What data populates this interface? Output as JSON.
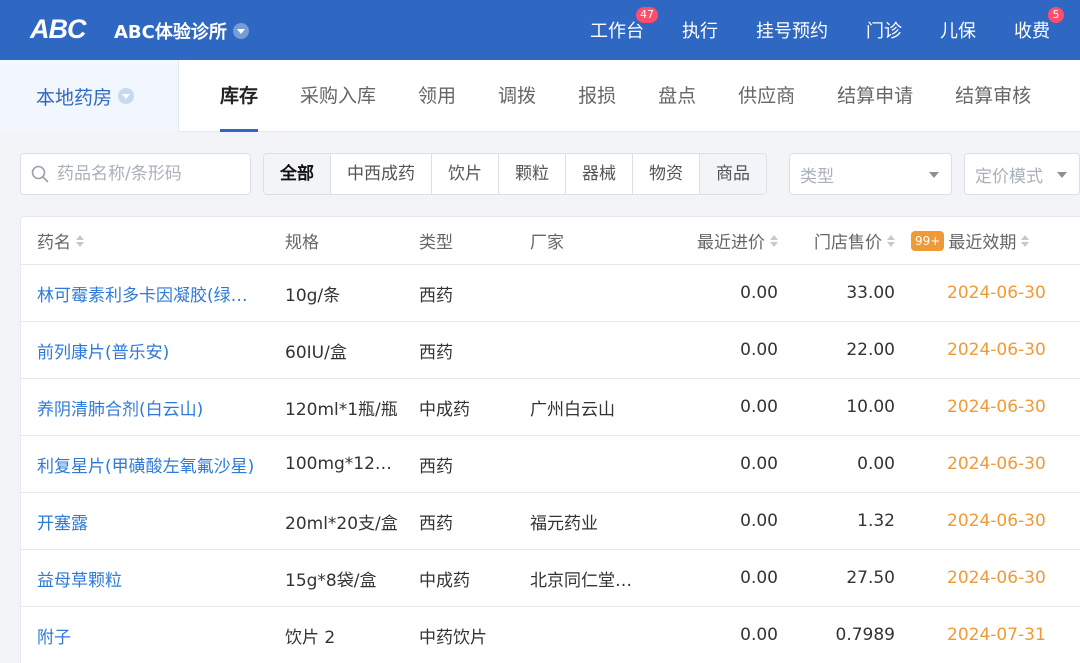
{
  "topbar": {
    "logo": "ABC",
    "clinic_name": "ABC体验诊所",
    "nav": [
      {
        "label": "工作台",
        "badge": "47"
      },
      {
        "label": "执行",
        "badge": ""
      },
      {
        "label": "挂号预约",
        "badge": ""
      },
      {
        "label": "门诊",
        "badge": ""
      },
      {
        "label": "儿保",
        "badge": ""
      },
      {
        "label": "收费",
        "badge": "5"
      }
    ]
  },
  "subbar": {
    "pharmacy": "本地药房",
    "tabs": [
      "库存",
      "采购入库",
      "领用",
      "调拨",
      "报损",
      "盘点",
      "供应商",
      "结算申请",
      "结算审核"
    ],
    "active_tab": "库存"
  },
  "filters": {
    "search_placeholder": "药品名称/条形码",
    "categories": [
      "全部",
      "中西成药",
      "饮片",
      "颗粒",
      "器械",
      "物资",
      "商品"
    ],
    "type_placeholder": "类型",
    "pricing_placeholder": "定价模式"
  },
  "table": {
    "headers": {
      "name": "药名",
      "spec": "规格",
      "type": "类型",
      "manufacturer": "厂家",
      "cost": "最近进价",
      "price": "门店售价",
      "expiry_badge": "99+",
      "expiry": "最近效期"
    },
    "rows": [
      {
        "name": "林可霉素利多卡因凝胶(绿…",
        "spec": "10g/条",
        "type": "西药",
        "manufacturer": "",
        "cost": "0.00",
        "price": "33.00",
        "expiry": "2024-06-30"
      },
      {
        "name": "前列康片(普乐安)",
        "spec": "60IU/盒",
        "type": "西药",
        "manufacturer": "",
        "cost": "0.00",
        "price": "22.00",
        "expiry": "2024-06-30"
      },
      {
        "name": "养阴清肺合剂(白云山)",
        "spec": "120ml*1瓶/瓶",
        "type": "中成药",
        "manufacturer": "广州白云山",
        "cost": "0.00",
        "price": "10.00",
        "expiry": "2024-06-30"
      },
      {
        "name": "利复星片(甲磺酸左氧氟沙星)",
        "spec": "100mg*12…",
        "type": "西药",
        "manufacturer": "",
        "cost": "0.00",
        "price": "0.00",
        "expiry": "2024-06-30"
      },
      {
        "name": "开塞露",
        "spec": "20ml*20支/盒",
        "type": "西药",
        "manufacturer": "福元药业",
        "cost": "0.00",
        "price": "1.32",
        "expiry": "2024-06-30"
      },
      {
        "name": "益母草颗粒",
        "spec": "15g*8袋/盒",
        "type": "中成药",
        "manufacturer": "北京同仁堂…",
        "cost": "0.00",
        "price": "27.50",
        "expiry": "2024-06-30"
      },
      {
        "name": "附子",
        "spec": "饮片 2",
        "type": "中药饮片",
        "manufacturer": "",
        "cost": "0.00",
        "price": "0.7989",
        "expiry": "2024-07-31"
      }
    ]
  }
}
